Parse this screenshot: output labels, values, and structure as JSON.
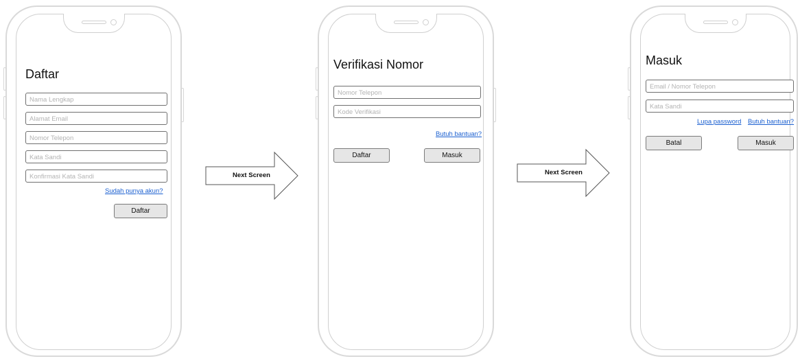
{
  "screens": {
    "daftar": {
      "title": "Daftar",
      "fields": {
        "nama_lengkap": "Nama Lengkap",
        "alamat_email": "Alamat Email",
        "nomor_telepon": "Nomor Telepon",
        "kata_sandi": "Kata Sandi",
        "konfirmasi": "Konfirmasi Kata Sandi"
      },
      "link_sudah_punya_akun": "Sudah punya akun?",
      "btn_daftar": "Daftar"
    },
    "verifikasi": {
      "title": "Verifikasi Nomor",
      "fields": {
        "nomor_telepon": "Nomor Telepon",
        "kode_verifikasi": "Kode Verifikasi"
      },
      "link_butuh_bantuan": "Butuh bantuan?",
      "btn_daftar": "Daftar",
      "btn_masuk": "Masuk"
    },
    "masuk": {
      "title": "Masuk",
      "fields": {
        "email_telepon": "Email / Nomor Telepon",
        "kata_sandi": "Kata Sandi"
      },
      "link_lupa_password": "Lupa password",
      "link_butuh_bantuan": "Butuh bantuan?",
      "btn_batal": "Batal",
      "btn_masuk": "Masuk"
    }
  },
  "arrows": {
    "first": "Next Screen",
    "second": "Next Screen"
  },
  "colors": {
    "link": "#1a5fd0",
    "button_bg": "#e6e6e6",
    "frame": "#cfcfcf"
  }
}
